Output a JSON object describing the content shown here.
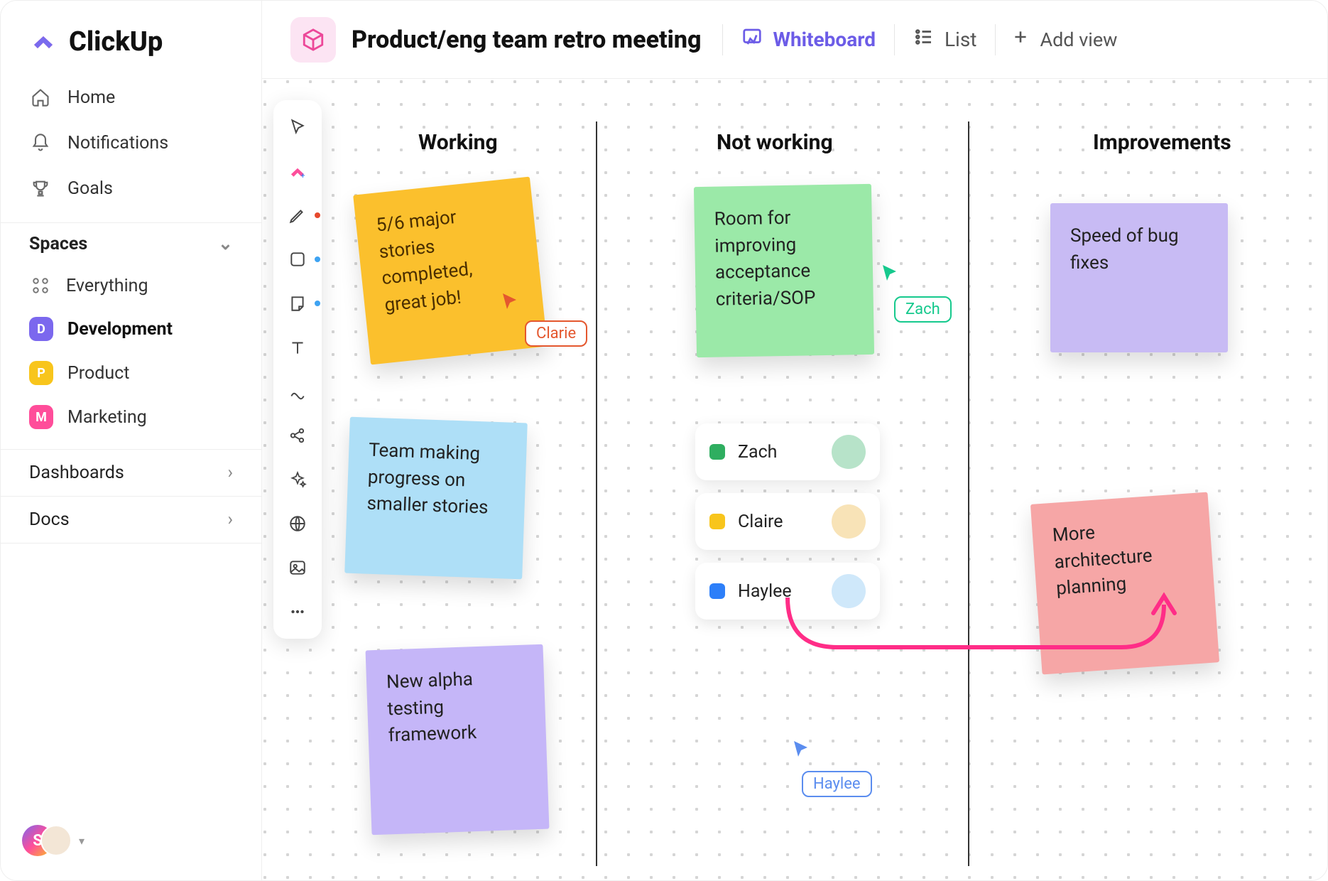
{
  "brand": "ClickUp",
  "sidebar": {
    "nav": [
      {
        "label": "Home",
        "icon": "home-icon"
      },
      {
        "label": "Notifications",
        "icon": "bell-icon"
      },
      {
        "label": "Goals",
        "icon": "trophy-icon"
      }
    ],
    "spaces_header": "Spaces",
    "spaces": [
      {
        "label": "Everything",
        "icon": "everything-icon",
        "letter": ""
      },
      {
        "label": "Development",
        "letter": "D",
        "color": "#7B68EE",
        "active": true
      },
      {
        "label": "Product",
        "letter": "P",
        "color": "#F8C51C"
      },
      {
        "label": "Marketing",
        "letter": "M",
        "color": "#FF4D9A"
      }
    ],
    "sections": [
      {
        "label": "Dashboards"
      },
      {
        "label": "Docs"
      }
    ],
    "user_initial": "S"
  },
  "header": {
    "title": "Product/eng team retro meeting",
    "views": {
      "whiteboard": "Whiteboard",
      "list": "List",
      "add": "Add view"
    }
  },
  "board": {
    "columns": [
      "Working",
      "Not working",
      "Improvements"
    ],
    "notes": {
      "n1": "5/6 major stories completed, great job!",
      "n2": "Team making progress on smaller stories",
      "n3": "New alpha testing framework",
      "n4": "Room for improving acceptance criteria/SOP",
      "n5": "Speed of bug fixes",
      "n6": "More architecture planning"
    },
    "tasks": [
      {
        "name": "Zach",
        "status": "green"
      },
      {
        "name": "Claire",
        "status": "yellow"
      },
      {
        "name": "Haylee",
        "status": "blue"
      }
    ],
    "cursors": {
      "clarie": "Clarie",
      "zach": "Zach",
      "haylee": "Haylee"
    }
  },
  "toolbar": [
    "cursor-tool",
    "clickup-ai-tool",
    "pen-tool",
    "shape-tool",
    "sticky-tool",
    "text-tool",
    "connector-tool",
    "share-tool",
    "sparkle-tool",
    "globe-tool",
    "image-tool",
    "more-tool"
  ]
}
